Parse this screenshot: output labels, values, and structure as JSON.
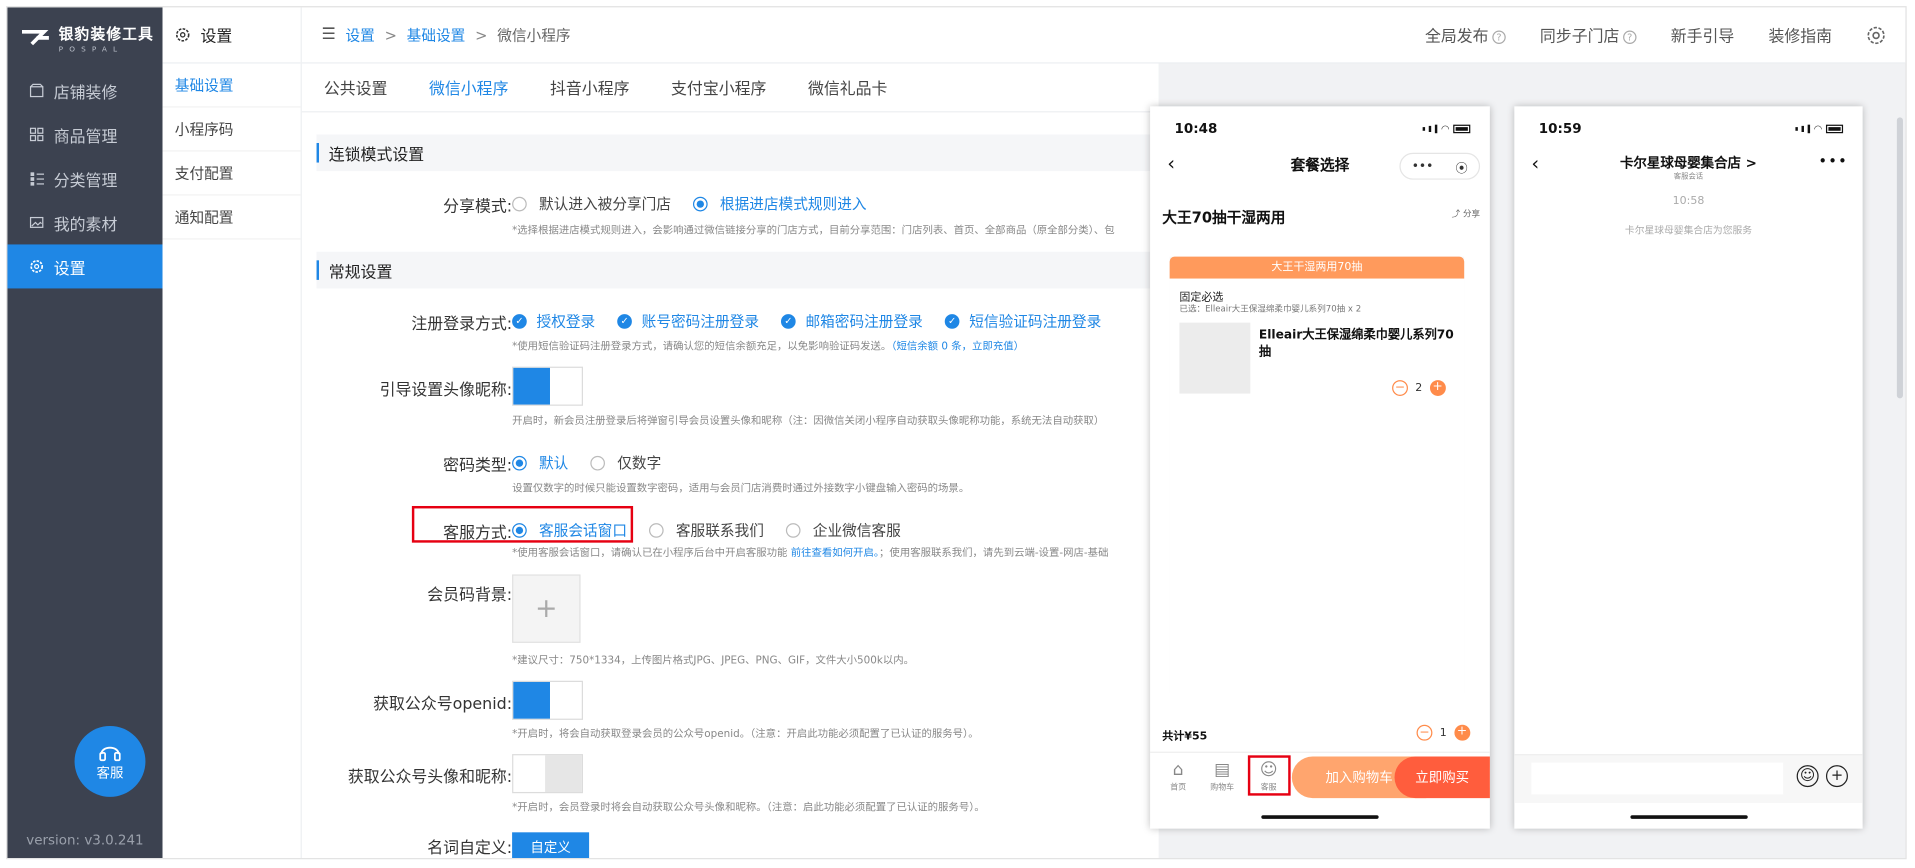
{
  "app": {
    "logo_name": "银豹装修工具",
    "logo_sub": "POSPAL"
  },
  "nav": {
    "items": [
      {
        "label": "店铺装修",
        "icon": "store-icon"
      },
      {
        "label": "商品管理",
        "icon": "grid-icon"
      },
      {
        "label": "分类管理",
        "icon": "list-icon"
      },
      {
        "label": "我的素材",
        "icon": "image-icon"
      },
      {
        "label": "设置",
        "icon": "gear-icon",
        "active": true
      }
    ],
    "service_label": "客服",
    "version": "version: v3.0.241"
  },
  "subnav": {
    "title": "设置",
    "items": [
      "基础设置",
      "小程序码",
      "支付配置",
      "通知配置"
    ]
  },
  "breadcrumb": {
    "items": [
      "设置",
      "基础设置",
      "微信小程序"
    ],
    "sep": ">"
  },
  "top_actions": {
    "publish": "全局发布",
    "sync": "同步子门店",
    "guide": "新手引导",
    "manual": "装修指南"
  },
  "tabs": [
    "公共设置",
    "微信小程序",
    "抖音小程序",
    "支付宝小程序",
    "微信礼品卡"
  ],
  "sections": {
    "chain": "连锁模式设置",
    "general": "常规设置"
  },
  "share_mode": {
    "label": "分享模式:",
    "options": [
      "默认进入被分享门店",
      "根据进店模式规则进入"
    ],
    "hint": "*选择根据进店模式规则进入，会影响通过微信链接分享的门店方式，目前分享范围：门店列表、首页、全部商品（原全部分类）、包"
  },
  "register": {
    "label": "注册登录方式:",
    "options": [
      "授权登录",
      "账号密码注册登录",
      "邮箱密码注册登录",
      "短信验证码注册登录"
    ],
    "hint": "*使用短信验证码注册登录方式，请确认您的短信余额充足，以免影响验证码发送。",
    "hint_link": "（短信余额 0 条，立即充值）"
  },
  "avatar_guide": {
    "label": "引导设置头像昵称:",
    "enabled": true,
    "hint": "开启时，新会员注册登录后将弹窗引导会员设置头像和昵称（注：因微信关闭小程序自动获取头像昵称功能，系统无法自动获取）"
  },
  "password": {
    "label": "密码类型:",
    "options": [
      "默认",
      "仅数字"
    ],
    "hint": "设置仅数字的时候只能设置数字密码，适用与会员门店消费时通过外接数字小键盘输入密码的场景。"
  },
  "customer_service": {
    "label": "客服方式:",
    "options": [
      "客服会话窗口",
      "客服联系我们",
      "企业微信客服"
    ],
    "hint": "*使用客服会话窗口，请确认已在小程序后台中开启客服功能",
    "hint_link": "前往查看如何开启。",
    "hint_tail": "；使用客服联系我们，请先到云端-设置-网店-基础"
  },
  "member_bg": {
    "label": "会员码背景:",
    "hint": "*建议尺寸：750*1334，上传图片格式JPG、JPEG、PNG、GIF，文件大小500k以内。"
  },
  "openid": {
    "label": "获取公众号openid:",
    "enabled": true,
    "hint": "*开启时，将会自动获取登录会员的公众号openid。（注意：开启此功能必须配置了已认证的服务号）。"
  },
  "profile": {
    "label": "获取公众号头像和昵称:",
    "enabled": false,
    "hint": "*开启时，会员登录时将会自动获取公众号头像和昵称。（注意：启此功能必须配置了已认证的服务号）。"
  },
  "rename": {
    "label": "名词自定义:",
    "button": "自定义"
  },
  "phone1": {
    "time": "10:48",
    "title": "套餐选择",
    "product": "大王70抽干湿两用",
    "share": "分享",
    "card_header": "大王干湿两用70抽",
    "fixed": "固定必选",
    "selected": "已选：Elleair大王保湿绵柔巾婴儿系列70抽 x 2",
    "item_name": "Elleair大王保湿绵柔巾婴儿系列70抽",
    "item_qty": "2",
    "total": "共计¥55",
    "total_qty": "1",
    "nav": [
      "首页",
      "购物车",
      "客服"
    ],
    "add_cart": "加入购物车",
    "buy_now": "立即购买"
  },
  "phone2": {
    "time": "10:59",
    "title": "卡尔星球母婴集合店 >",
    "subtitle": "客服会话",
    "msg_time": "10:58",
    "msg": "卡尔星球母婴集合店为您服务"
  },
  "colors": {
    "accent": "#1f87e5",
    "sidebar": "#3c4250",
    "orange": "#ff8b4a",
    "highlight": "#e60012"
  }
}
